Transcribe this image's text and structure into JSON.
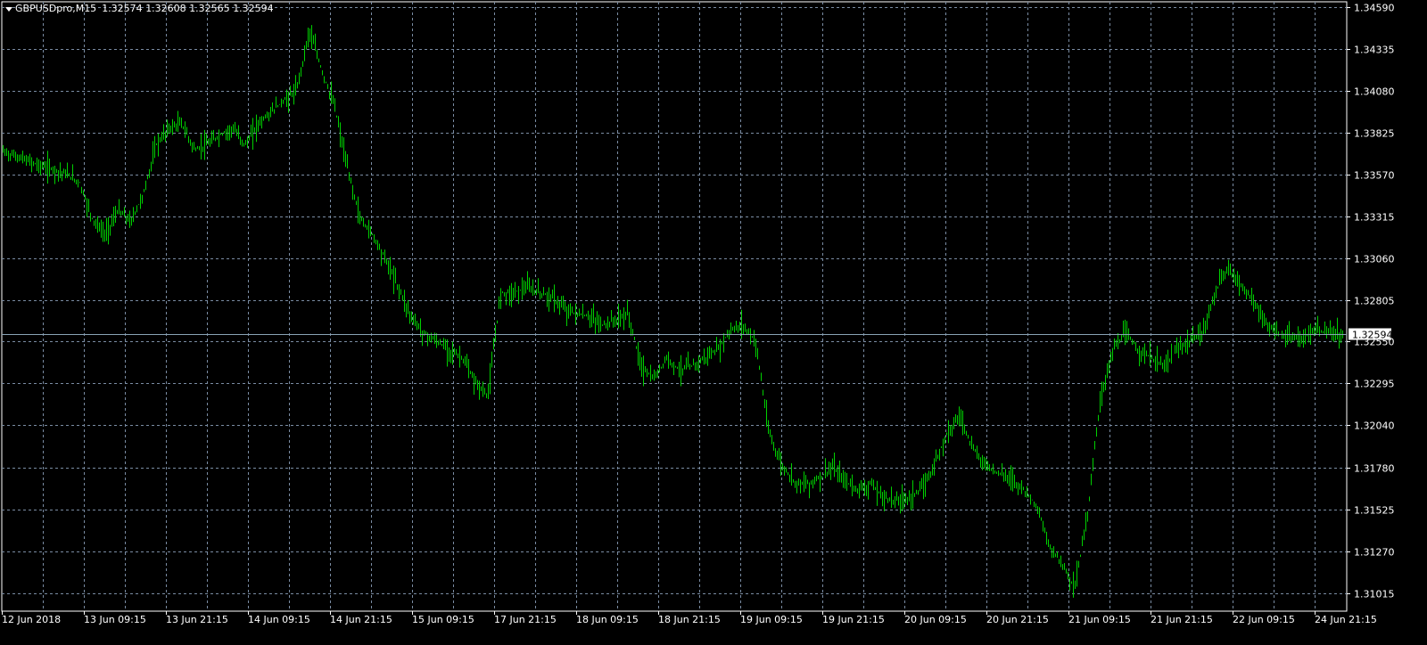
{
  "window": {
    "symbol_timeframe": "GBPUSDpro,M15",
    "open": "1.32574",
    "high": "1.32608",
    "low": "1.32565",
    "close": "1.32594"
  },
  "current_price": {
    "label": "1.32594",
    "value": 1.32594
  },
  "colors": {
    "background": "#000000",
    "grid": "#7a8ca3",
    "candles": "#00d000",
    "price_line": "#8aa3b5",
    "text": "#ffffff"
  },
  "chart_data": {
    "type": "line",
    "series": [
      {
        "values": [
          1.3371,
          1.3368,
          1.3365,
          1.3362,
          1.336,
          1.3357,
          1.3352,
          1.333,
          1.332,
          1.3335,
          1.3328,
          1.3345,
          1.3375,
          1.3385,
          1.3388,
          1.3372,
          1.3375,
          1.3381,
          1.3385,
          1.3375,
          1.3388,
          1.3395,
          1.3402,
          1.3408,
          1.3445,
          1.342,
          1.3398,
          1.336,
          1.333,
          1.332,
          1.3305,
          1.3288,
          1.327,
          1.326,
          1.3255,
          1.325,
          1.3245,
          1.323,
          1.3222,
          1.3285,
          1.3285,
          1.3288,
          1.3285,
          1.3282,
          1.3275,
          1.3272,
          1.327,
          1.3265,
          1.3268,
          1.3272,
          1.324,
          1.3232,
          1.3245,
          1.3238,
          1.324,
          1.3245,
          1.325,
          1.3262,
          1.3265,
          1.3255,
          1.32,
          1.318,
          1.317,
          1.3168,
          1.3172,
          1.3178,
          1.317,
          1.3165,
          1.3168,
          1.316,
          1.3158,
          1.316,
          1.3165,
          1.318,
          1.32,
          1.321,
          1.319,
          1.318,
          1.3175,
          1.3172,
          1.3165,
          1.3155,
          1.313,
          1.312,
          1.3105,
          1.315,
          1.322,
          1.325,
          1.326,
          1.325,
          1.3245,
          1.324,
          1.325,
          1.3255,
          1.326,
          1.3285,
          1.33,
          1.329,
          1.328,
          1.3265,
          1.326,
          1.3256,
          1.3258,
          1.3262,
          1.326,
          1.32594
        ],
        "x_index_note": ""
      }
    ],
    "ylim": [
      1.3095,
      1.3467
    ],
    "y_ticks": [
      "1.34590",
      "1.34335",
      "1.34080",
      "1.33825",
      "1.33570",
      "1.33315",
      "1.33060",
      "1.32805",
      "1.32550",
      "1.32295",
      "1.32040",
      "1.31780",
      "1.31525",
      "1.31270",
      "1.31015"
    ],
    "x_ticks": [
      "12 Jun 2018",
      "13 Jun 09:15",
      "13 Jun 21:15",
      "14 Jun 09:15",
      "14 Jun 21:15",
      "15 Jun 09:15",
      "17 Jun 21:15",
      "18 Jun 09:15",
      "18 Jun 21:15",
      "19 Jun 09:15",
      "19 Jun 21:15",
      "20 Jun 09:15",
      "20 Jun 21:15",
      "21 Jun 09:15",
      "21 Jun 21:15",
      "22 Jun 09:15",
      "24 Jun 21:15"
    ],
    "grid": true
  }
}
